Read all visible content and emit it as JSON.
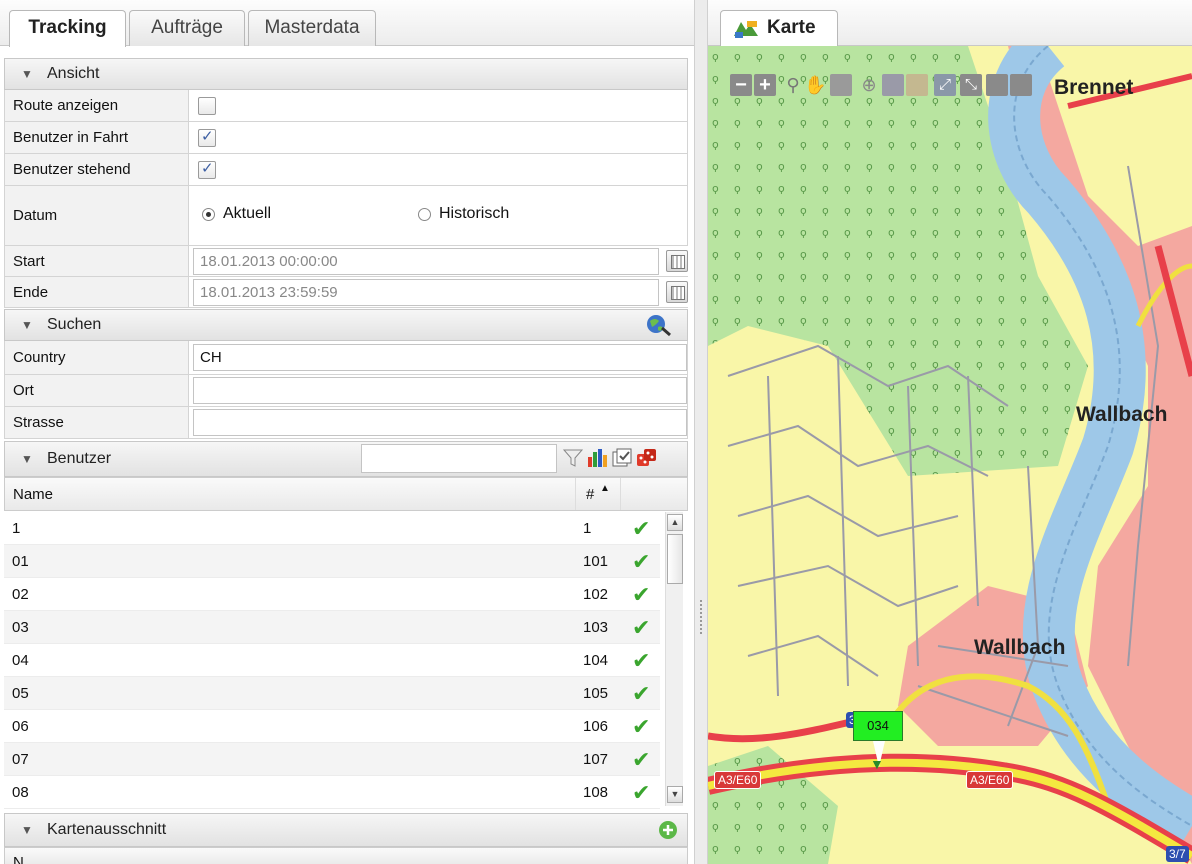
{
  "left_tabs": [
    {
      "label": "Tracking",
      "active": true
    },
    {
      "label": "Aufträge",
      "active": false
    },
    {
      "label": "Masterdata",
      "active": false
    }
  ],
  "ansicht": {
    "title": "Ansicht",
    "route_label": "Route anzeigen",
    "route_checked": false,
    "fahrt_label": "Benutzer in Fahrt",
    "fahrt_checked": true,
    "stehend_label": "Benutzer stehend",
    "stehend_checked": true,
    "datum_label": "Datum",
    "aktuell_label": "Aktuell",
    "historisch_label": "Historisch",
    "datum_selected": "Aktuell",
    "start_label": "Start",
    "start_value": "18.01.2013 00:00:00",
    "ende_label": "Ende",
    "ende_value": "18.01.2013 23:59:59"
  },
  "suchen": {
    "title": "Suchen",
    "country_label": "Country",
    "country_value": "CH",
    "ort_label": "Ort",
    "ort_value": "",
    "strasse_label": "Strasse",
    "strasse_value": ""
  },
  "benutzer": {
    "title": "Benutzer",
    "filter_value": "",
    "col_name": "Name",
    "col_num": "#",
    "rows": [
      {
        "name": "1",
        "num": "1"
      },
      {
        "name": "01",
        "num": "101"
      },
      {
        "name": "02",
        "num": "102"
      },
      {
        "name": "03",
        "num": "103"
      },
      {
        "name": "04",
        "num": "104"
      },
      {
        "name": "05",
        "num": "105"
      },
      {
        "name": "06",
        "num": "106"
      },
      {
        "name": "07",
        "num": "107"
      },
      {
        "name": "08",
        "num": "108"
      }
    ]
  },
  "kartenausschnitt": {
    "title": "Kartenausschnitt",
    "col_name": "N"
  },
  "map": {
    "tab_label": "Karte",
    "places": [
      "Brennet",
      "Wallbach",
      "Wallbach"
    ],
    "road_labels": [
      "A3/E60",
      "A3/E60",
      "3/7"
    ],
    "marker_label": "034",
    "route_number": "3"
  },
  "colors": {
    "road": "#e8404a",
    "water": "#9ec8e8",
    "forest": "#b8e4a0",
    "town": "#f4a8a0",
    "background": "#f9f6a8",
    "marker": "#22ee22"
  }
}
